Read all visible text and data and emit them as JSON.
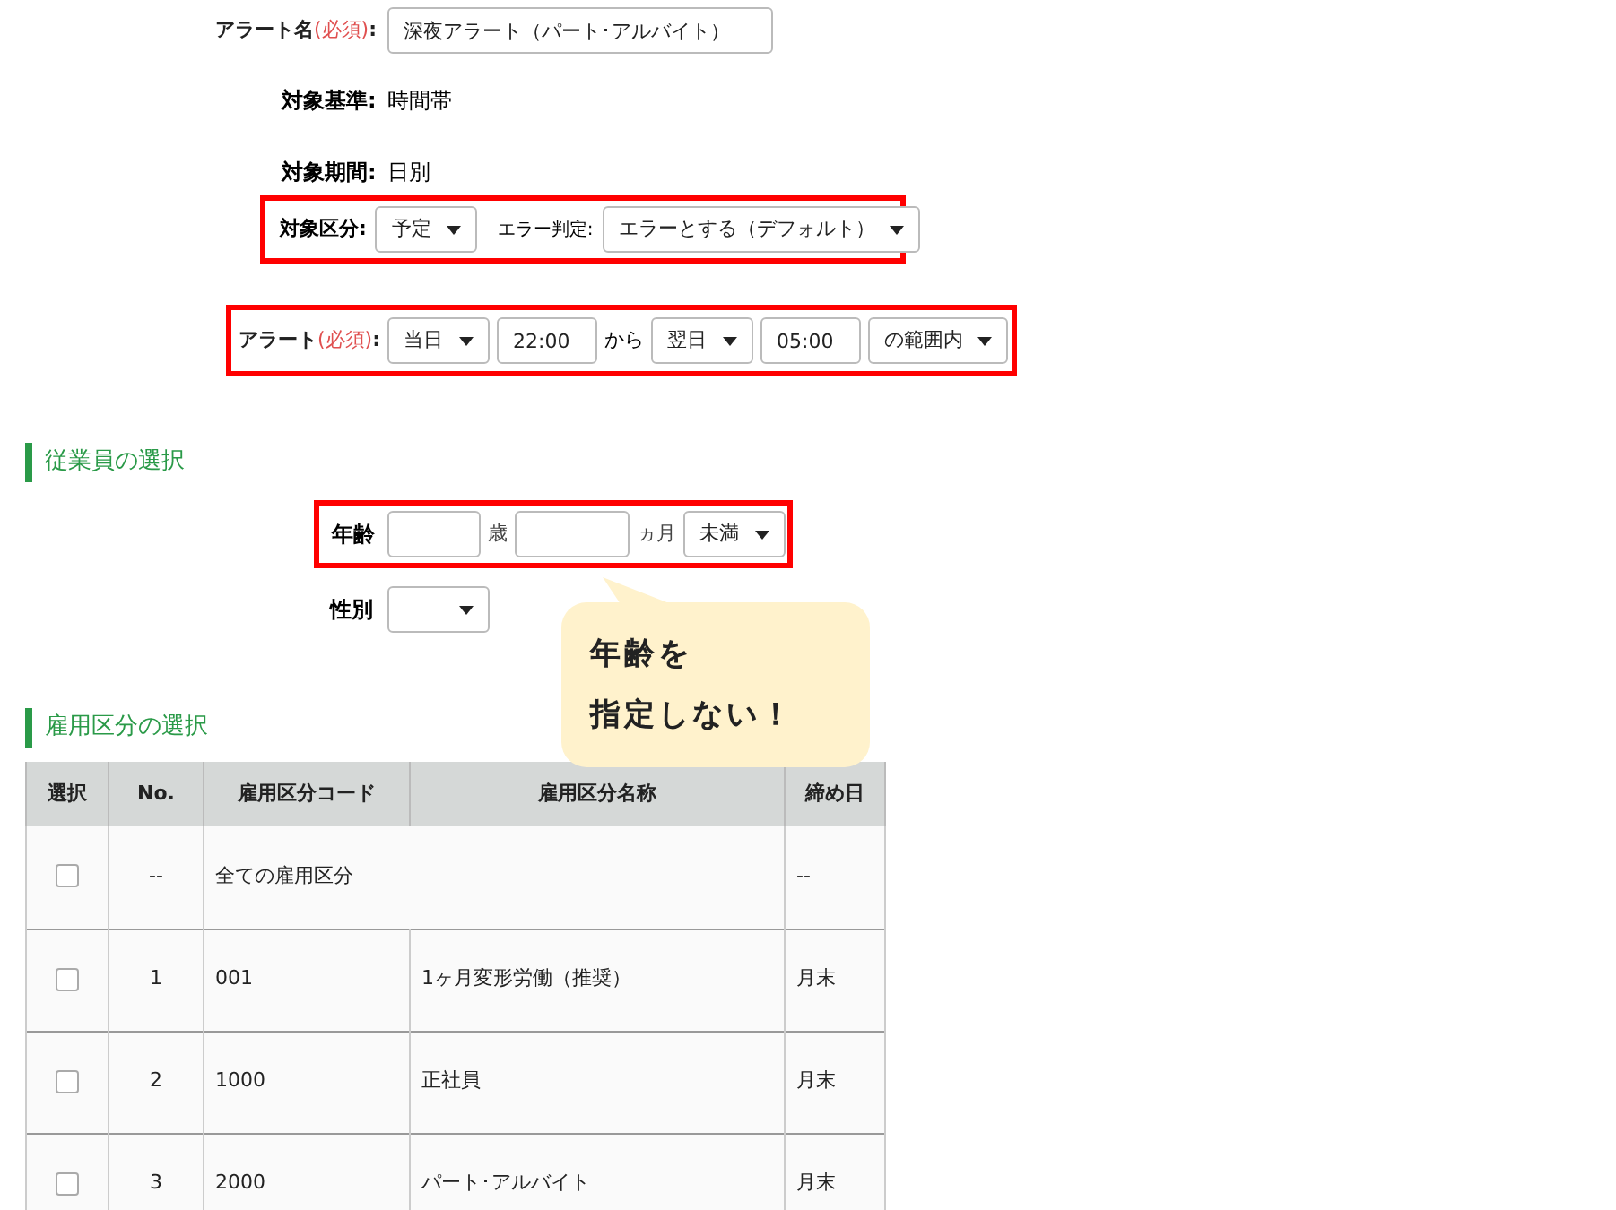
{
  "alert_name": {
    "label": "アラート名",
    "required": "(必須)",
    "separator": ":",
    "value": "深夜アラート（パート･アルバイト）"
  },
  "target_basis": {
    "label": "対象基準:",
    "value": "時間帯"
  },
  "target_period": {
    "label": "対象期間:",
    "value": "日別"
  },
  "target_class": {
    "label": "対象区分:",
    "select": "予定",
    "error_label": "エラー判定:",
    "error_select": "エラーとする（デフォルト）"
  },
  "alert": {
    "label": "アラート",
    "required": "(必須)",
    "separator": ":",
    "start_day": "当日",
    "start_time": "22:00",
    "from": "から",
    "end_day": "翌日",
    "end_time": "05:00",
    "range": "の範囲内"
  },
  "employee_section": {
    "title": "従業員の選択",
    "age_label": "年齢",
    "years_unit": "歳",
    "months_unit": "ヵ月",
    "age_condition": "未満",
    "gender_label": "性別"
  },
  "callout": {
    "lines": [
      "年齢を",
      "指定しない！"
    ]
  },
  "employment_section": {
    "title": "雇用区分の選択"
  },
  "table": {
    "columns": [
      "選択",
      "No.",
      "雇用区分コード",
      "雇用区分名称",
      "締め日"
    ],
    "rows": [
      {
        "checked": false,
        "no": "--",
        "code": "全ての雇用区分",
        "name": "",
        "closing": "--"
      },
      {
        "checked": false,
        "no": "1",
        "code": "001",
        "name": "1ヶ月変形労働（推奨）",
        "closing": "月末"
      },
      {
        "checked": false,
        "no": "2",
        "code": "1000",
        "name": "正社員",
        "closing": "月末"
      },
      {
        "checked": false,
        "no": "3",
        "code": "2000",
        "name": "パート･アルバイト",
        "closing": "月末"
      }
    ]
  }
}
